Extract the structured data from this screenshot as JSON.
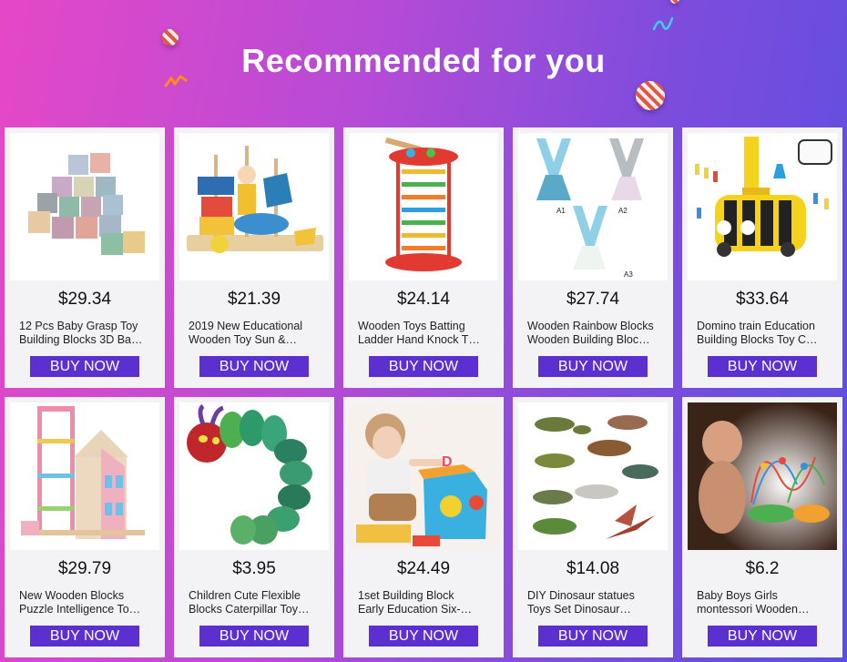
{
  "banner": {
    "title": "Recommended for you"
  },
  "products": [
    {
      "price": "$29.34",
      "title_line1": "12 Pcs Baby Grasp Toy",
      "title_line2": "Building Blocks 3D Ba…",
      "button": "BUY NOW",
      "image_icon": "stacked-blocks-icon"
    },
    {
      "price": "$21.39",
      "title_line1": "2019 New Educational",
      "title_line2": "Wooden Toy Sun &…",
      "button": "BUY NOW",
      "image_icon": "stacking-toy-icon"
    },
    {
      "price": "$24.14",
      "title_line1": "Wooden Toys Batting",
      "title_line2": "Ladder Hand Knock T…",
      "button": "BUY NOW",
      "image_icon": "ladder-toy-icon"
    },
    {
      "price": "$27.74",
      "title_line1": "Wooden Rainbow Blocks",
      "title_line2": "Wooden Building Bloc…",
      "button": "BUY NOW",
      "image_icon": "tent-blocks-icon",
      "image_labels": [
        "A1",
        "A2",
        "A3"
      ]
    },
    {
      "price": "$33.64",
      "title_line1": "Domino train Education",
      "title_line2": "Building Blocks Toy C…",
      "button": "BUY NOW",
      "image_icon": "domino-train-icon"
    },
    {
      "price": "$29.79",
      "title_line1": "New Wooden Blocks",
      "title_line2": "Puzzle Intelligence To…",
      "button": "BUY NOW",
      "image_icon": "wooden-house-icon"
    },
    {
      "price": "$3.95",
      "title_line1": "Children Cute Flexible",
      "title_line2": "Blocks Caterpillar Toy…",
      "button": "BUY NOW",
      "image_icon": "caterpillar-icon"
    },
    {
      "price": "$24.49",
      "title_line1": "1set Building Block",
      "title_line2": "Early Education Six-…",
      "button": "BUY NOW",
      "image_icon": "activity-cube-icon"
    },
    {
      "price": "$14.08",
      "title_line1": "DIY Dinosaur statues",
      "title_line2": "Toys Set Dinosaur…",
      "button": "BUY NOW",
      "image_icon": "dinosaur-set-icon"
    },
    {
      "price": "$6.2",
      "title_line1": "Baby Boys Girls",
      "title_line2": "montessori Wooden…",
      "button": "BUY NOW",
      "image_icon": "bead-maze-icon"
    }
  ]
}
